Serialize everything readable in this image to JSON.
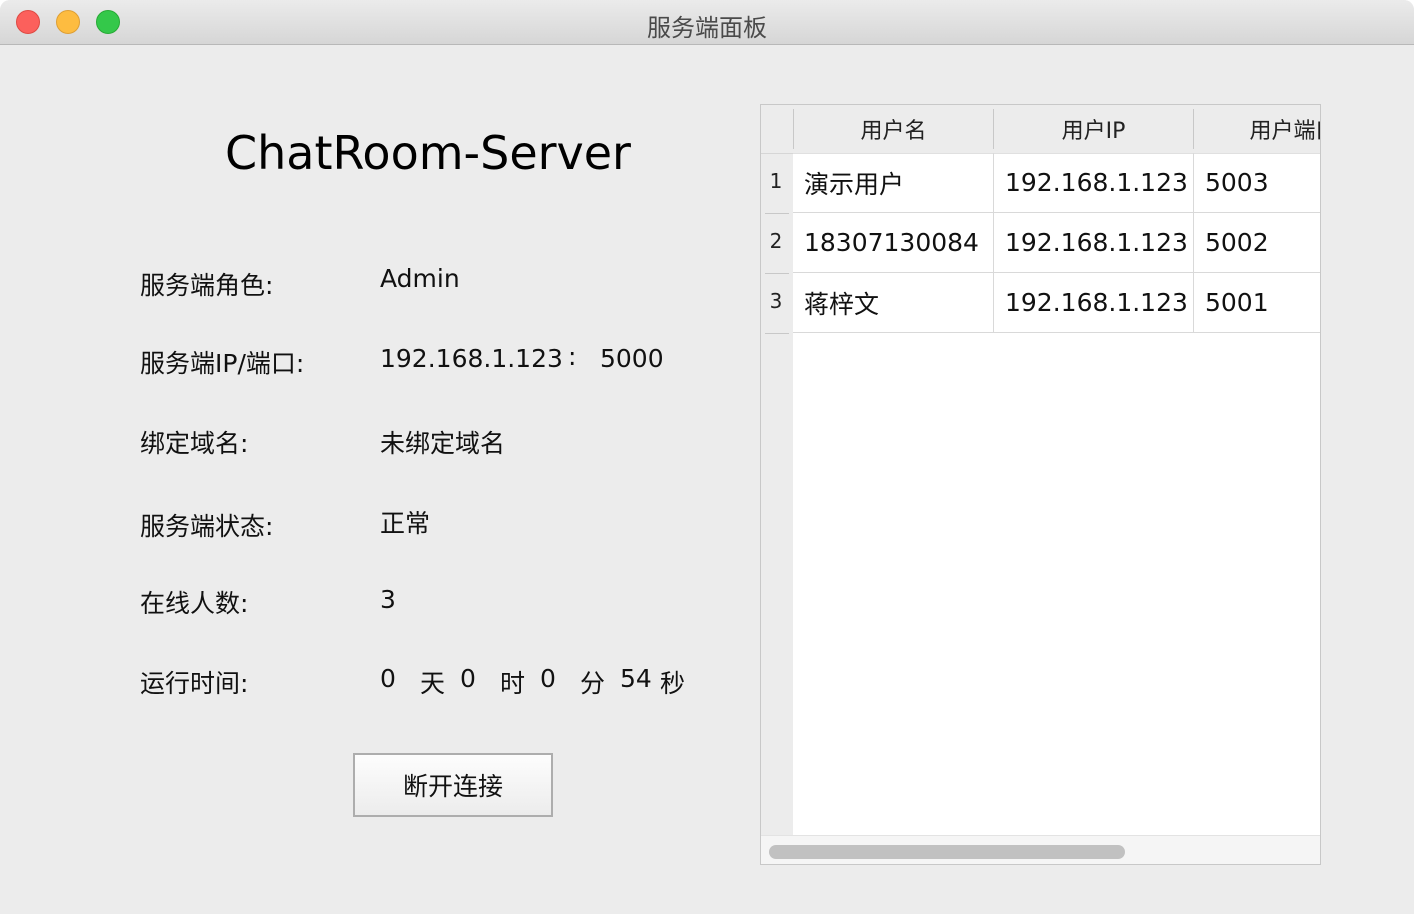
{
  "window": {
    "title": "服务端面板"
  },
  "panel": {
    "heading": "ChatRoom-Server",
    "role_label": "服务端角色:",
    "role_value": "Admin",
    "ip_port_label": "服务端IP/端口:",
    "ip_value": "192.168.1.123",
    "ip_port_separator": ":",
    "port_value": "5000",
    "domain_label": "绑定域名:",
    "domain_value": "未绑定域名",
    "status_label": "服务端状态:",
    "status_value": "正常",
    "online_label": "在线人数:",
    "online_value": "3",
    "uptime_label": "运行时间:",
    "uptime": {
      "days": "0",
      "days_unit": "天",
      "hours": "0",
      "hours_unit": "时",
      "minutes": "0",
      "minutes_unit": "分",
      "seconds": "54",
      "seconds_unit": "秒"
    },
    "disconnect_label": "断开连接"
  },
  "user_table": {
    "columns": [
      "用户名",
      "用户IP",
      "用户端口"
    ],
    "rows": [
      {
        "num": "1",
        "name": "演示用户",
        "ip": "192.168.1.123",
        "port": "5003"
      },
      {
        "num": "2",
        "name": "18307130084",
        "ip": "192.168.1.123",
        "port": "5002"
      },
      {
        "num": "3",
        "name": "蒋梓文",
        "ip": "192.168.1.123",
        "port": "5001"
      }
    ]
  },
  "colors": {
    "window_bg": "#ececec",
    "close": "#fc605c",
    "minimize": "#fdbc40",
    "maximize": "#34c84a"
  }
}
